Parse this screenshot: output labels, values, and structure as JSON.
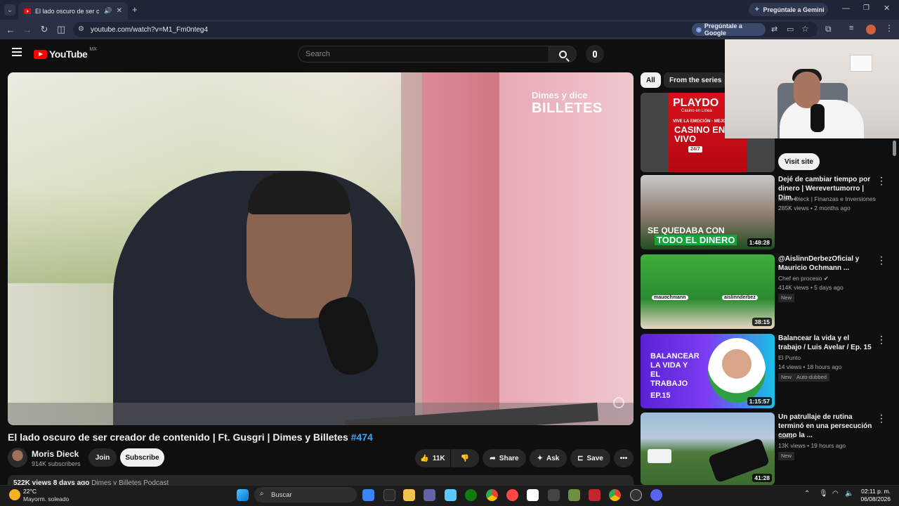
{
  "browser": {
    "tab_title": "El lado oscuro de ser creador de contenido",
    "url": "youtube.com/watch?v=M1_Fm0nteg4",
    "gemini_button": "Pregúntale a Gemini",
    "ask_google_button": "Pregúntale a Google"
  },
  "youtube": {
    "logo_text": "YouTube",
    "region": "MX",
    "search_placeholder": "Search"
  },
  "player": {
    "watermark_small": "Dimes y dice",
    "watermark_big": "BILLETES"
  },
  "video": {
    "title": "El lado oscuro de ser creador de contenido | Ft. Gusgri | Dimes y Billetes",
    "hashtag": "#474",
    "channel": "Moris Dieck",
    "subscribers": "914K subscribers",
    "join": "Join",
    "subscribe": "Subscribe",
    "likes": "11K",
    "share": "Share",
    "ask": "Ask",
    "save": "Save",
    "views_line": "522K views  8 days ago",
    "views_desc": "Dimes y Billetes Podcast"
  },
  "sidebar": {
    "chips": [
      "All",
      "From the series"
    ],
    "ad": {
      "brand": "PLAYDO",
      "sub": "Casino en Línea",
      "line": "VIVE LA EMOCIÓN · MEJOR",
      "big": "CASINO EN VIVO",
      "hours": "24/7",
      "visit": "Visit site"
    },
    "recs": [
      {
        "title": "Dejé de cambiar tiempo por dinero | Werevertumorro | Dim...",
        "channel": "Moris Dieck | Finanzas e Inversiones",
        "meta": "285K views • 2 months ago",
        "duration": "1:48:28",
        "thumb_text": "SE QUEDABA CON",
        "thumb_text2": "TODO EL DINERO",
        "badges": []
      },
      {
        "title": "@AislinnDerbezOficial y Mauricio Ochmann ...",
        "channel": "Chef en proceso",
        "meta": "414K views • 5 days ago",
        "duration": "38:15",
        "thumb_text": "mauochmann",
        "thumb_text2": "aislinnderbez",
        "badges": [
          "New"
        ]
      },
      {
        "title": "Balancear la vida y el trabajo / Luis Avelar / Ep. 15",
        "channel": "El Punto",
        "meta": "14 views • 18 hours ago",
        "duration": "1:15:57",
        "thumb_text": "BALANCEAR LA VIDA Y EL TRABAJO",
        "thumb_text2": "EP.15",
        "badges": [
          "New",
          "Auto-dubbed"
        ]
      },
      {
        "title": "Un patrullaje de rutina terminó en una persecución como la ...",
        "channel": "Sumo",
        "meta": "13K views • 19 hours ago",
        "duration": "41:28",
        "thumb_text": "",
        "thumb_text2": "",
        "badges": [
          "New"
        ]
      }
    ]
  },
  "taskbar": {
    "temperature": "22°C",
    "weather": "Mayorm. soleado",
    "search": "Buscar",
    "time": "02:11 p. m.",
    "date": "06/08/2026"
  },
  "colors": {
    "yt_red": "#ff0000",
    "link_blue": "#3ea6ff",
    "bg": "#0f0f0f"
  }
}
